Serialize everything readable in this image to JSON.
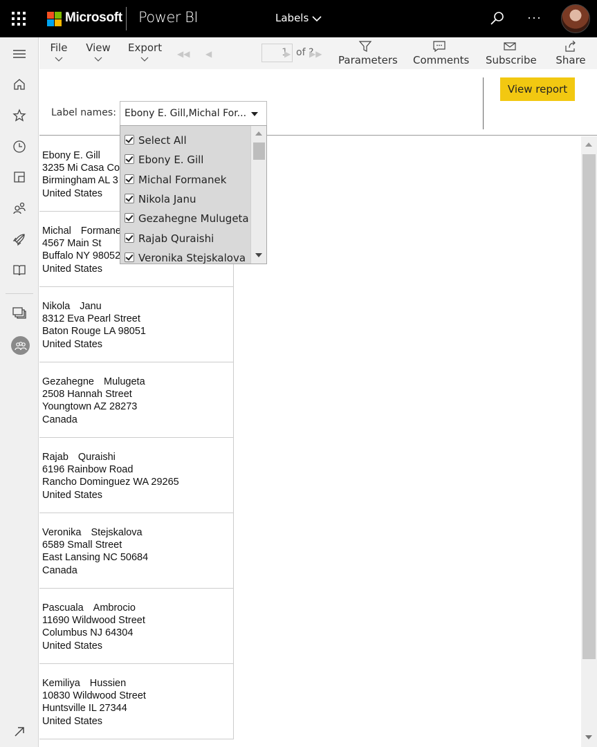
{
  "app": {
    "brand": "Microsoft",
    "product": "Power BI",
    "report_name": "Labels"
  },
  "command_bar": {
    "menus": [
      "File",
      "View",
      "Export"
    ],
    "page_number": "1",
    "page_of": "of ?",
    "actions": {
      "parameters": "Parameters",
      "comments": "Comments",
      "subscribe": "Subscribe",
      "share": "Share"
    }
  },
  "params": {
    "label": "Label names:",
    "selected_text": "Ebony E. Gill,Michal For...",
    "view_report": "View report",
    "options": [
      "Select All",
      "Ebony E. Gill",
      "Michal Formanek",
      "Nikola Janu",
      "Gezahegne Mulugeta",
      "Rajab Quraishi",
      "Veronika Stejskalova"
    ]
  },
  "labels": [
    {
      "first": "Ebony E. Gill",
      "last": "",
      "street": "3235 Mi Casa Co",
      "city": "Birmingham AL 3",
      "country": "United States"
    },
    {
      "first": "Michal",
      "last": "Formane",
      "street": "4567 Main St",
      "city": "Buffalo NY 98052",
      "country": "United States"
    },
    {
      "first": "Nikola",
      "last": "Janu",
      "street": "8312 Eva Pearl Street",
      "city": "Baton Rouge LA 98051",
      "country": "United States"
    },
    {
      "first": "Gezahegne",
      "last": "Mulugeta",
      "street": "2508 Hannah Street",
      "city": "Youngtown AZ 28273",
      "country": "Canada"
    },
    {
      "first": "Rajab",
      "last": "Quraishi",
      "street": "6196 Rainbow Road",
      "city": "Rancho Dominguez WA 29265",
      "country": "United States"
    },
    {
      "first": "Veronika",
      "last": "Stejskalova",
      "street": "6589 Small Street",
      "city": "East Lansing NC 50684",
      "country": "Canada"
    },
    {
      "first": "Pascuala",
      "last": "Ambrocio",
      "street": "11690 Wildwood Street",
      "city": "Columbus NJ 64304",
      "country": "United States"
    },
    {
      "first": "Kemiliya",
      "last": "Hussien",
      "street": "10830 Wildwood Street",
      "city": "Huntsville IL 27344",
      "country": "United States"
    }
  ],
  "colors": {
    "topbar": "#000000",
    "accent_button": "#f2c811",
    "ms_red": "#f25022",
    "ms_green": "#7fba00",
    "ms_blue": "#00a4ef",
    "ms_yellow": "#ffb900"
  },
  "rail_icons": [
    "hamburger-icon",
    "home-icon",
    "star-icon",
    "clock-icon",
    "apps-icon",
    "shared-icon",
    "rocket-icon",
    "book-icon",
    "workspaces-icon",
    "workspace-avatar-icon",
    "expand-icon"
  ]
}
